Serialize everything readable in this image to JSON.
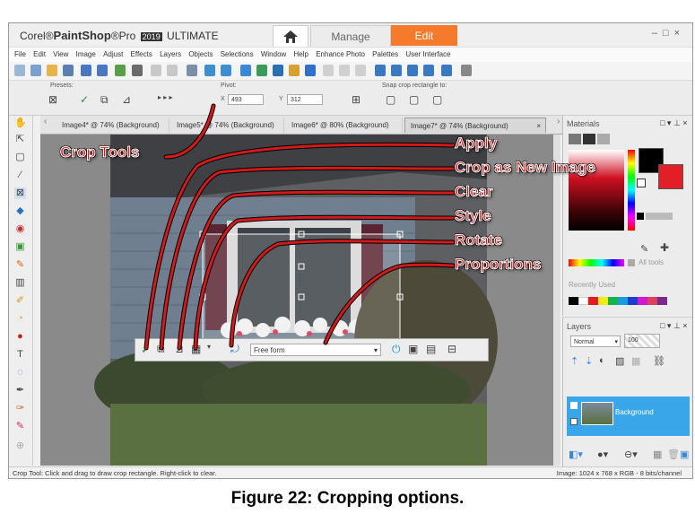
{
  "app": {
    "brand_corel": "Corel®",
    "brand_name": "PaintShop",
    "brand_pro": "®Pro",
    "brand_year": "2019",
    "brand_edition": "ULTIMATE",
    "tab_manage": "Manage",
    "tab_edit": "Edit"
  },
  "menu": [
    "File",
    "Edit",
    "View",
    "Image",
    "Adjust",
    "Effects",
    "Layers",
    "Objects",
    "Selections",
    "Window",
    "Help",
    "Enhance Photo",
    "Palettes",
    "User Interface"
  ],
  "options": {
    "presets_label": "Presets:",
    "pivot_label": "Pivot:",
    "x_label": "X",
    "x_value": "493",
    "y_label": "Y",
    "y_value": "312",
    "snap_label": "Snap crop rectangle to:"
  },
  "doc_tabs": [
    "Image4* @ 74% (Background)",
    "Image5* @ 74% (Background)",
    "Image6* @ 80% (Background)",
    "Image7* @ 74% (Background)"
  ],
  "crop_toolbar": {
    "style_value": "Free form"
  },
  "materials": {
    "title": "Materials",
    "all_tools": "All tools",
    "recently_used": "Recently Used"
  },
  "layers": {
    "title": "Layers",
    "blend_mode": "Normal",
    "opacity": "100",
    "layer_name": "Background"
  },
  "status": {
    "left": "Crop Tool: Click and drag to draw crop rectangle. Right-click to clear.",
    "right": "Image:  1024 x 768 x RGB - 8 bits/channel"
  },
  "callouts": {
    "crop_tools": "Crop Tools",
    "apply": "Apply",
    "crop_new": "Crop as New Image",
    "clear": "Clear",
    "style": "Style",
    "rotate": "Rotate",
    "proportions": "Proportions"
  },
  "caption": "Figure 22: Cropping options.",
  "colors": {
    "edit_tab": "#f57a2b",
    "callout": "#d11a1a",
    "selected_layer": "#3aa6ea"
  }
}
